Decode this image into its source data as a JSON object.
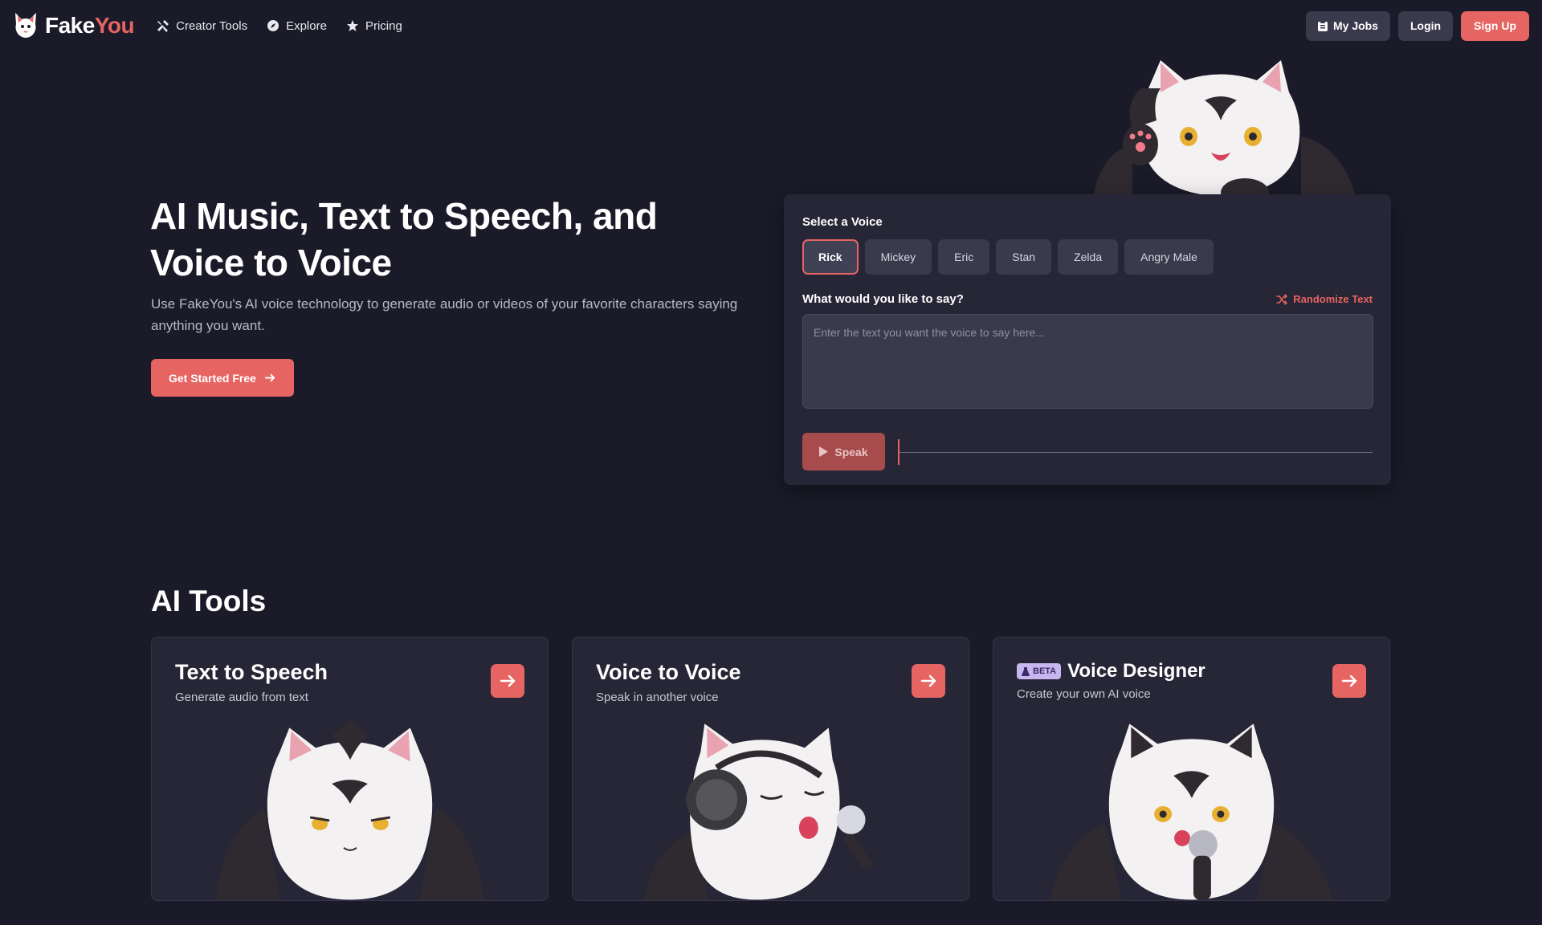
{
  "brand": {
    "name_a": "Fake",
    "name_b": "You"
  },
  "nav": {
    "links": [
      {
        "label": "Creator Tools",
        "icon": "tools-icon"
      },
      {
        "label": "Explore",
        "icon": "compass-icon"
      },
      {
        "label": "Pricing",
        "icon": "star-icon"
      }
    ],
    "my_jobs": "My Jobs",
    "login": "Login",
    "signup": "Sign Up"
  },
  "hero": {
    "title": "AI Music, Text to Speech, and Voice to Voice",
    "subtitle": "Use FakeYou's AI voice technology to generate audio or videos of your favorite characters saying anything you want.",
    "cta": "Get Started Free"
  },
  "tts_panel": {
    "select_label": "Select a Voice",
    "voices": [
      "Rick",
      "Mickey",
      "Eric",
      "Stan",
      "Zelda",
      "Angry Male"
    ],
    "selected_voice": "Rick",
    "say_label": "What would you like to say?",
    "randomize": "Randomize Text",
    "placeholder": "Enter the text you want the voice to say here...",
    "speak": "Speak"
  },
  "tools": {
    "title": "AI Tools",
    "cards": [
      {
        "title": "Text to Speech",
        "subtitle": "Generate audio from text"
      },
      {
        "title": "Voice to Voice",
        "subtitle": "Speak in another voice"
      },
      {
        "title": "Voice Designer",
        "subtitle": "Create your own AI voice",
        "badge": "BETA"
      }
    ]
  },
  "colors": {
    "accent": "#e66462",
    "background": "#1a1a29",
    "panel": "#262636",
    "chip": "#3a3a4c"
  }
}
